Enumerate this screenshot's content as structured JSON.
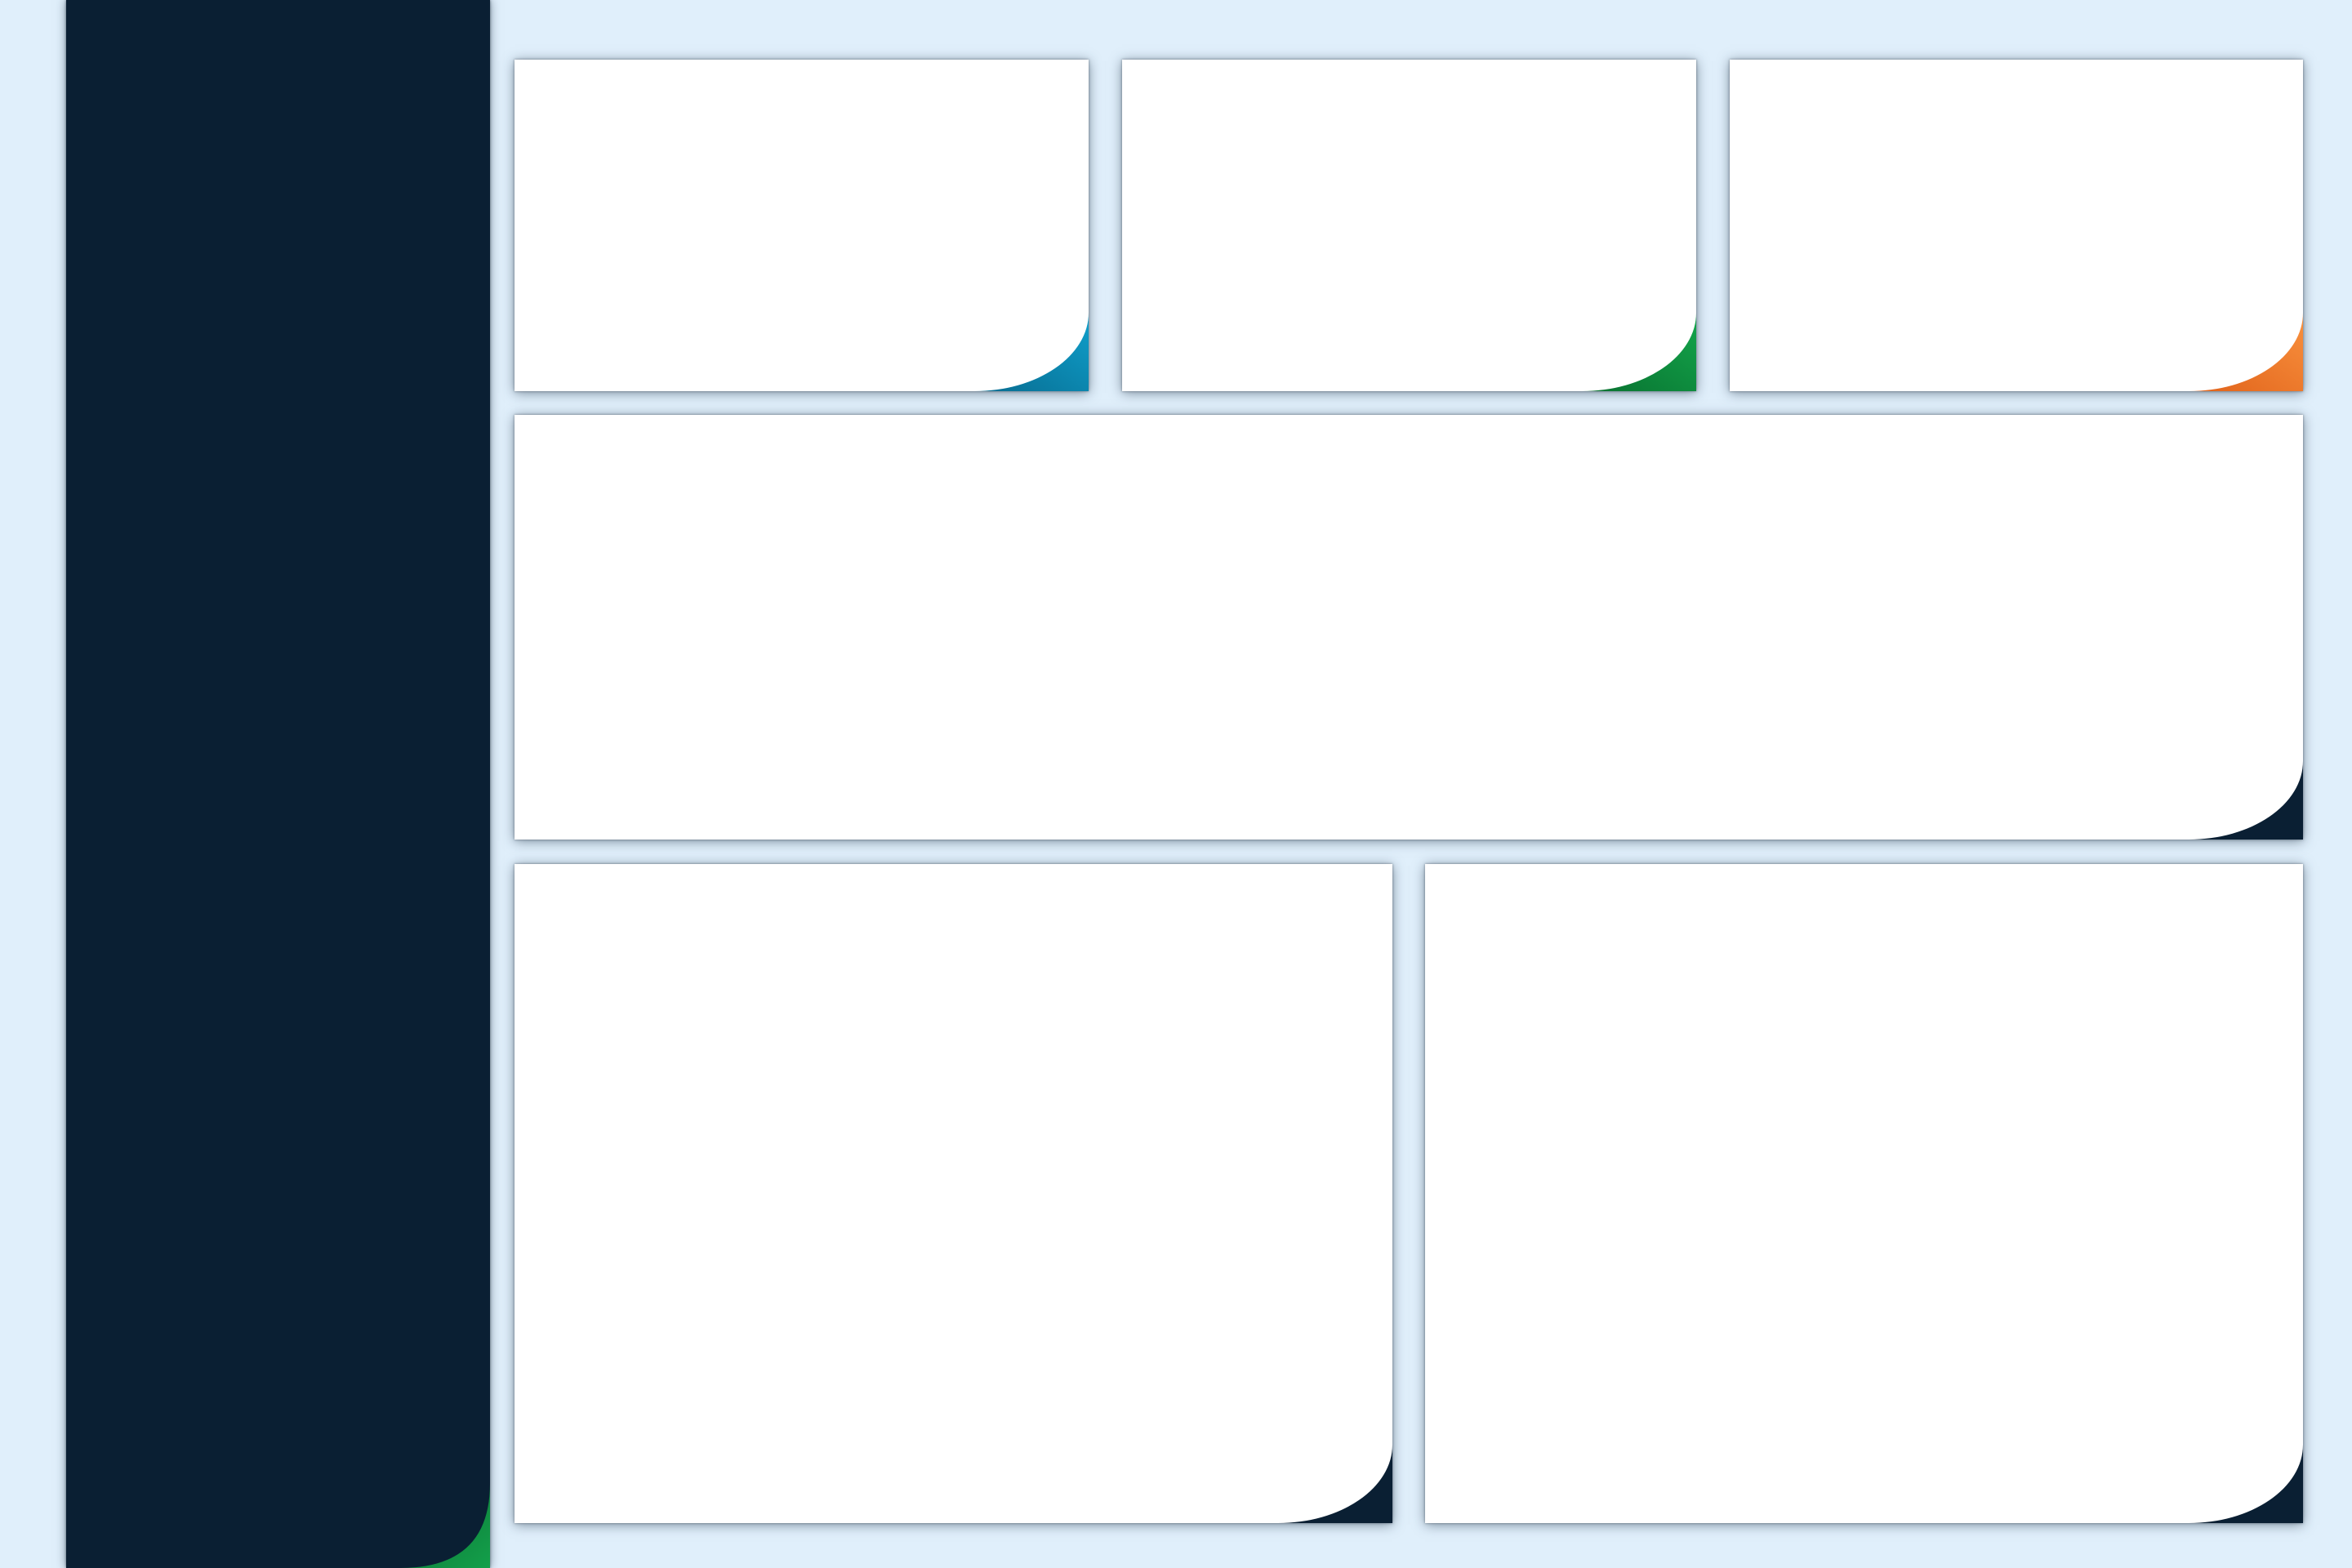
{
  "colors": {
    "background": "#e0effb",
    "sidebar": "#0a1f33",
    "card": "#ffffff",
    "accent_blue": "#0b7fa8",
    "accent_green": "#0e8a3e",
    "accent_orange": "#f07a2a",
    "accent_navy": "#0a1f33"
  },
  "sidebar": {
    "corner_color": "#0e8a3e"
  },
  "cards": {
    "kpi_1": {
      "corner_color": "#0b7fa8"
    },
    "kpi_2": {
      "corner_color": "#0e8a3e"
    },
    "kpi_3": {
      "corner_color": "#f07a2a"
    },
    "wide_panel": {
      "corner_color": "#0a1f33"
    },
    "bottom_left_panel": {
      "corner_color": "#0a1f33"
    },
    "bottom_right_panel": {
      "corner_color": "#0a1f33"
    }
  }
}
